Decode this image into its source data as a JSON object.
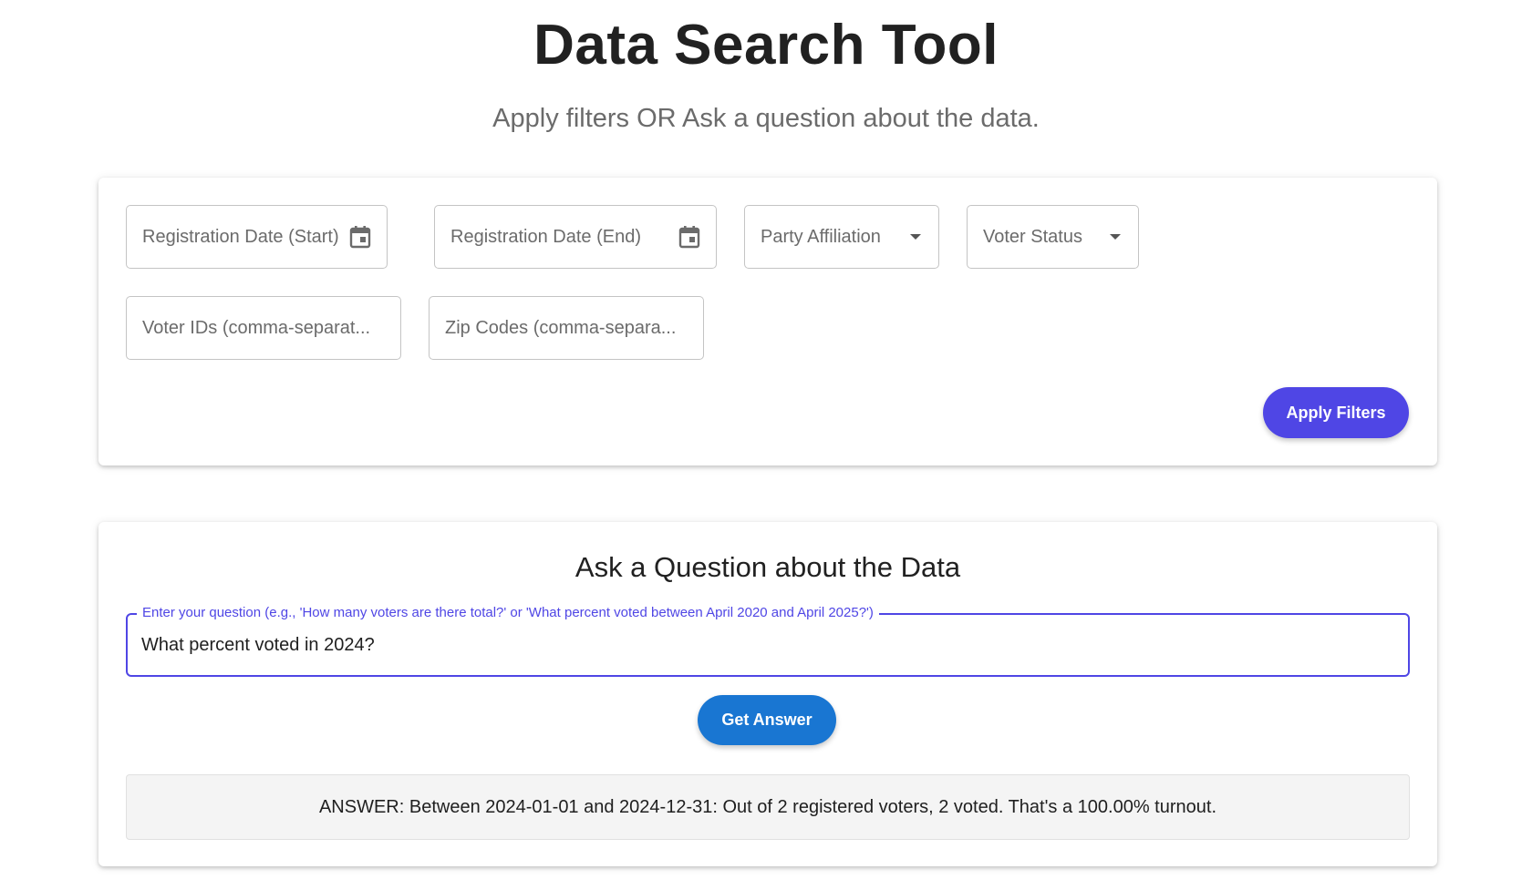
{
  "header": {
    "title": "Data Search Tool",
    "subtitle": "Apply filters OR Ask a question about the data."
  },
  "filters": {
    "registration_start": {
      "label": "Registration Date (Start)",
      "icon": "calendar-icon"
    },
    "registration_end": {
      "label": "Registration Date (End)",
      "icon": "calendar-icon"
    },
    "party_affiliation": {
      "label": "Party Affiliation",
      "icon": "dropdown-arrow-icon"
    },
    "voter_status": {
      "label": "Voter Status",
      "icon": "dropdown-arrow-icon"
    },
    "voter_ids": {
      "placeholder": "Voter IDs (comma-separat..."
    },
    "zip_codes": {
      "placeholder": "Zip Codes (comma-separa..."
    },
    "apply_label": "Apply Filters"
  },
  "question": {
    "heading": "Ask a Question about the Data",
    "input_label": "Enter your question (e.g., 'How many voters are there total?' or 'What percent voted between April 2020 and April 2025?')",
    "input_value": "What percent voted in 2024?",
    "submit_label": "Get Answer",
    "answer": "ANSWER: Between 2024-01-01 and 2024-12-31: Out of 2 registered voters, 2 voted. That's a 100.00% turnout."
  },
  "colors": {
    "primary": "#4f46e5",
    "answer_button": "#1976d2"
  }
}
